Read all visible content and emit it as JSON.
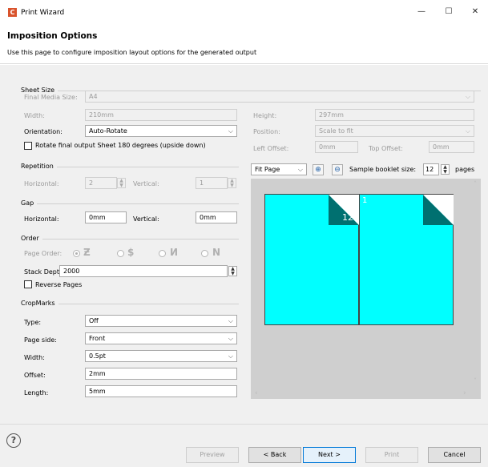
{
  "window": {
    "title": "Print Wizard",
    "app_icon_letter": "C",
    "minimize": "—",
    "maximize": "☐",
    "close": "✕"
  },
  "header": {
    "title": "Imposition Options",
    "description": "Use this page to configure imposition layout options for the generated output"
  },
  "sheet_size": {
    "section_title": "Sheet Size",
    "final_media_label": "Final Media Size:",
    "final_media_value": "A4",
    "width_label": "Width:",
    "width_value": "210mm",
    "height_label": "Height:",
    "height_value": "297mm",
    "orientation_label": "Orientation:",
    "orientation_value": "Auto-Rotate",
    "position_label": "Position:",
    "position_value": "Scale to fit",
    "rotate_label": "Rotate final output Sheet 180 degrees (upside down)",
    "left_offset_label": "Left Offset:",
    "left_offset_value": "0mm",
    "top_offset_label": "Top Offset:",
    "top_offset_value": "0mm"
  },
  "repetition": {
    "section_title": "Repetition",
    "horizontal_label": "Horizontal:",
    "horizontal_value": "2",
    "vertical_label": "Vertical:",
    "vertical_value": "1"
  },
  "gap": {
    "section_title": "Gap",
    "horizontal_label": "Horizontal:",
    "horizontal_value": "0mm",
    "vertical_label": "Vertical:",
    "vertical_value": "0mm"
  },
  "order": {
    "section_title": "Order",
    "page_order_label": "Page Order:",
    "stack_depth_label": "Stack Depth:",
    "stack_depth_value": "2000",
    "reverse_pages_label": "Reverse Pages"
  },
  "cropmarks": {
    "section_title": "CropMarks",
    "type_label": "Type:",
    "type_value": "Off",
    "page_side_label": "Page side:",
    "page_side_value": "Front",
    "width_label": "Width:",
    "width_value": "0.5pt",
    "offset_label": "Offset:",
    "offset_value": "2mm",
    "length_label": "Length:",
    "length_value": "5mm"
  },
  "preview": {
    "zoom_value": "Fit Page",
    "zoom_in_icon": "zoom-in-icon",
    "zoom_out_icon": "zoom-out-icon",
    "sample_size_label": "Sample booklet size:",
    "sample_size_value": "12",
    "pages_label": "pages",
    "left_page_number": "12",
    "right_page_number": "1",
    "page_color": "#00ffff",
    "fold_color": "#007070"
  },
  "footer": {
    "help_icon": "?",
    "preview_button": "Preview",
    "back_button": "< Back",
    "next_button": "Next >",
    "print_button": "Print",
    "cancel_button": "Cancel"
  }
}
